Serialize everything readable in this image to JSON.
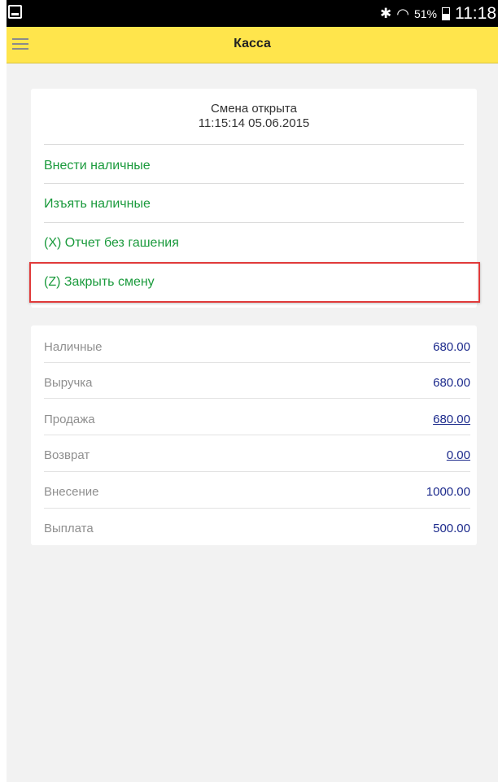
{
  "statusbar": {
    "battery": "51%",
    "time": "11:18"
  },
  "appbar": {
    "title": "Касса"
  },
  "shift": {
    "status": "Смена открыта",
    "datetime": "11:15:14 05.06.2015"
  },
  "actions": [
    {
      "label": "Внести наличные"
    },
    {
      "label": "Изъять наличные"
    },
    {
      "label": "(X) Отчет без гашения"
    },
    {
      "label": "(Z) Закрыть смену"
    }
  ],
  "summary": [
    {
      "label": "Наличные",
      "value": "680.00"
    },
    {
      "label": "Выручка",
      "value": "680.00"
    },
    {
      "label": "Продажа",
      "value": "680.00"
    },
    {
      "label": "Возврат",
      "value": "0.00"
    },
    {
      "label": "Внесение",
      "value": "1000.00"
    },
    {
      "label": "Выплата",
      "value": "500.00"
    }
  ],
  "colors": {
    "appbar": "#ffe54c",
    "action_text": "#1a9a3c",
    "value_text": "#1c2a8c",
    "highlight": "#e03a3a"
  }
}
